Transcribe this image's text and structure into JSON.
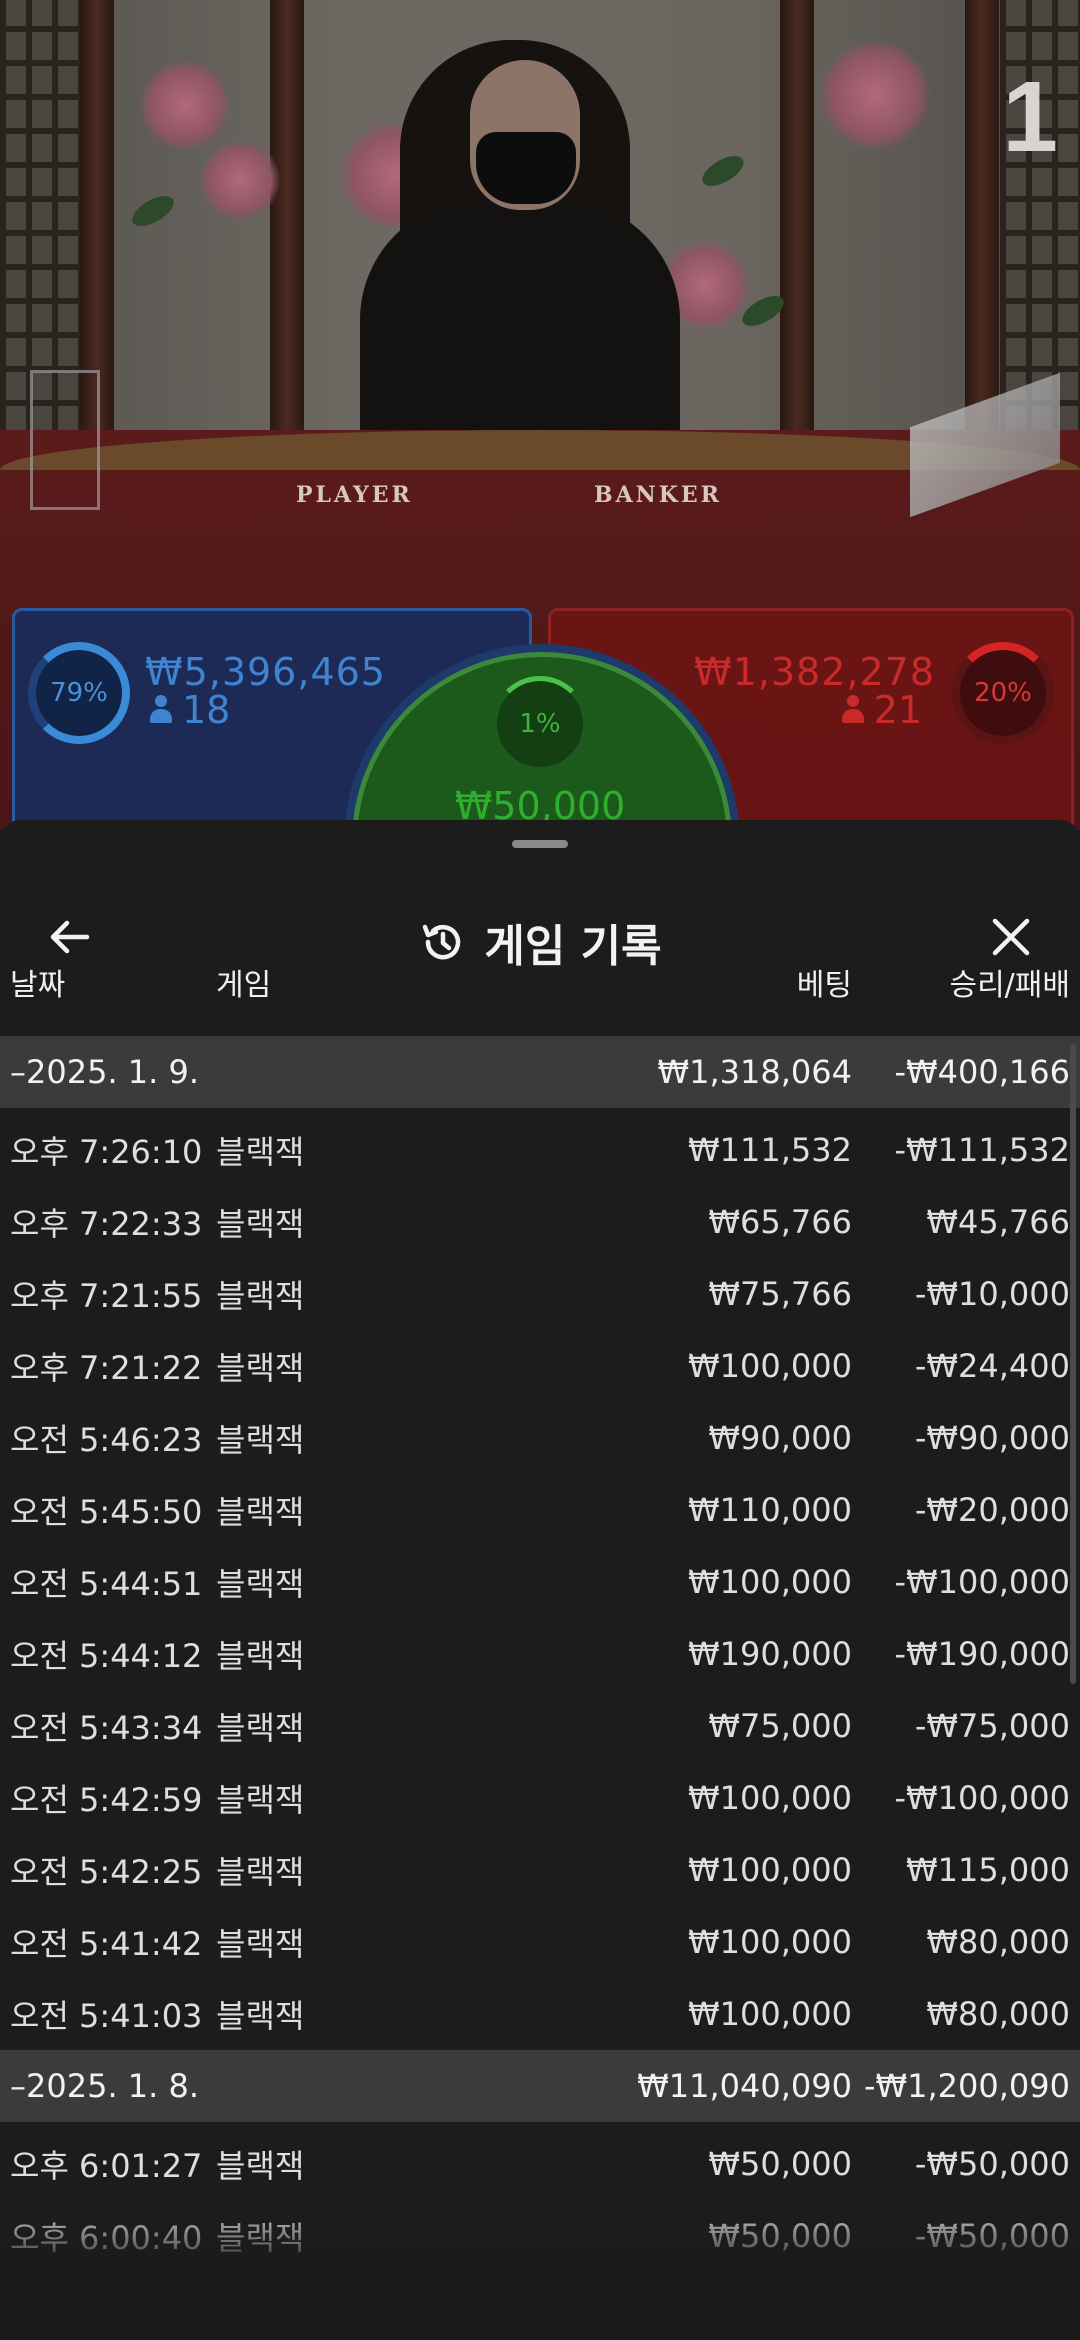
{
  "stage": {
    "round_number": "1",
    "felt_left": "PLAYER",
    "felt_right": "BANKER",
    "player": {
      "percent": "79%",
      "amount": "₩5,396,465",
      "count": "18"
    },
    "banker": {
      "percent": "20%",
      "amount": "₩1,382,278",
      "count": "21"
    },
    "tie": {
      "percent": "1%",
      "amount": "₩50,000"
    },
    "colors": {
      "player": "#3f84d2",
      "banker": "#c92a2a",
      "tie": "#2fae2f"
    }
  },
  "sheet": {
    "title": "게임 기록",
    "back_icon": "arrow-left-icon",
    "history_icon": "history-icon",
    "close_icon": "close-icon",
    "columns": {
      "date": "날짜",
      "game": "게임",
      "bet": "베팅",
      "result": "승리/패배"
    },
    "groups": [
      {
        "date": "–2025. 1. 9.",
        "bet_total": "₩1,318,064",
        "result_total": "-₩400,166",
        "rows": [
          {
            "time": "오후 7:26:10",
            "game": "블랙잭",
            "bet": "₩111,532",
            "result": "-₩111,532"
          },
          {
            "time": "오후 7:22:33",
            "game": "블랙잭",
            "bet": "₩65,766",
            "result": "₩45,766"
          },
          {
            "time": "오후 7:21:55",
            "game": "블랙잭",
            "bet": "₩75,766",
            "result": "-₩10,000"
          },
          {
            "time": "오후 7:21:22",
            "game": "블랙잭",
            "bet": "₩100,000",
            "result": "-₩24,400"
          },
          {
            "time": "오전 5:46:23",
            "game": "블랙잭",
            "bet": "₩90,000",
            "result": "-₩90,000"
          },
          {
            "time": "오전 5:45:50",
            "game": "블랙잭",
            "bet": "₩110,000",
            "result": "-₩20,000"
          },
          {
            "time": "오전 5:44:51",
            "game": "블랙잭",
            "bet": "₩100,000",
            "result": "-₩100,000"
          },
          {
            "time": "오전 5:44:12",
            "game": "블랙잭",
            "bet": "₩190,000",
            "result": "-₩190,000"
          },
          {
            "time": "오전 5:43:34",
            "game": "블랙잭",
            "bet": "₩75,000",
            "result": "-₩75,000"
          },
          {
            "time": "오전 5:42:59",
            "game": "블랙잭",
            "bet": "₩100,000",
            "result": "-₩100,000"
          },
          {
            "time": "오전 5:42:25",
            "game": "블랙잭",
            "bet": "₩100,000",
            "result": "₩115,000"
          },
          {
            "time": "오전 5:41:42",
            "game": "블랙잭",
            "bet": "₩100,000",
            "result": "₩80,000"
          },
          {
            "time": "오전 5:41:03",
            "game": "블랙잭",
            "bet": "₩100,000",
            "result": "₩80,000"
          }
        ]
      },
      {
        "date": "–2025. 1. 8.",
        "bet_total": "₩11,040,090",
        "result_total": "-₩1,200,090",
        "rows": [
          {
            "time": "오후 6:01:27",
            "game": "블랙잭",
            "bet": "₩50,000",
            "result": "-₩50,000"
          },
          {
            "time": "오후 6:00:40",
            "game": "블랙잭",
            "bet": "₩50,000",
            "result": "-₩50,000"
          }
        ]
      }
    ]
  }
}
